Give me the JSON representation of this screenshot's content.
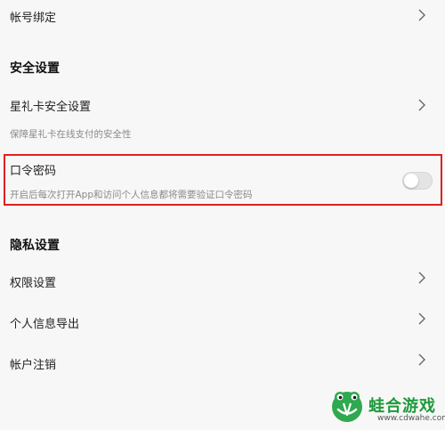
{
  "rows": {
    "account_binding": {
      "label": "帐号绑定"
    },
    "star_card": {
      "label": "星礼卡安全设置",
      "desc": "保障星礼卡在线支付的安全性"
    },
    "passcode": {
      "label": "口令密码",
      "desc": "开启后每次打开App和访问个人信息都将需要验证口令密码",
      "toggle_on": false
    },
    "permissions": {
      "label": "权限设置"
    },
    "export_info": {
      "label": "个人信息导出"
    },
    "account_cancel": {
      "label": "帐户注销"
    }
  },
  "sections": {
    "security": "安全设置",
    "privacy": "隐私设置"
  },
  "watermark": {
    "title": "蛙合游戏",
    "url": "www.cdwahe.com"
  },
  "colors": {
    "highlight_border": "#e02020",
    "watermark_green": "#1e9a3c"
  }
}
